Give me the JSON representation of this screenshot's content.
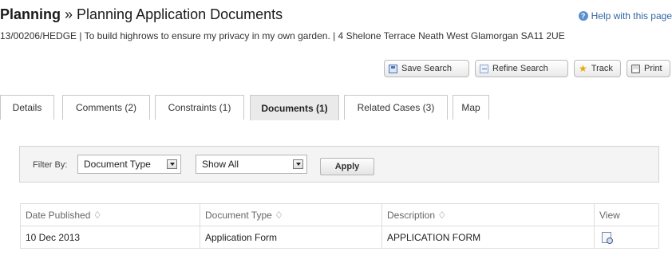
{
  "header": {
    "section": "Planning",
    "separator": " » ",
    "page_title": "Planning Application Documents",
    "help_link": "Help with this page",
    "subtitle": "13/00206/HEDGE | To build highrows to ensure my privacy in my own garden. | 4 Shelone Terrace Neath West Glamorgan SA11 2UE"
  },
  "toolbar": {
    "save_search": "Save Search",
    "refine_search": "Refine Search",
    "track": "Track",
    "print": "Print"
  },
  "tabs": [
    {
      "label": "Details",
      "active": false
    },
    {
      "label": "Comments (2)",
      "active": false
    },
    {
      "label": "Constraints (1)",
      "active": false
    },
    {
      "label": "Documents (1)",
      "active": true
    },
    {
      "label": "Related Cases (3)",
      "active": false
    },
    {
      "label": "Map",
      "active": false
    }
  ],
  "filter": {
    "label": "Filter By:",
    "type_value": "Document Type",
    "show_value": "Show All",
    "apply_label": "Apply"
  },
  "table": {
    "headers": [
      "Date Published ♢",
      "Document Type ♢",
      "Description ♢",
      "View"
    ],
    "rows": [
      {
        "date": "10 Dec 2013",
        "type": "Application Form",
        "description": "APPLICATION FORM",
        "view_icon": "document-view-icon"
      }
    ]
  },
  "icons": {
    "help": "help-icon",
    "save": "save-icon",
    "refine": "refine-icon",
    "track": "star-icon",
    "print": "print-icon"
  }
}
